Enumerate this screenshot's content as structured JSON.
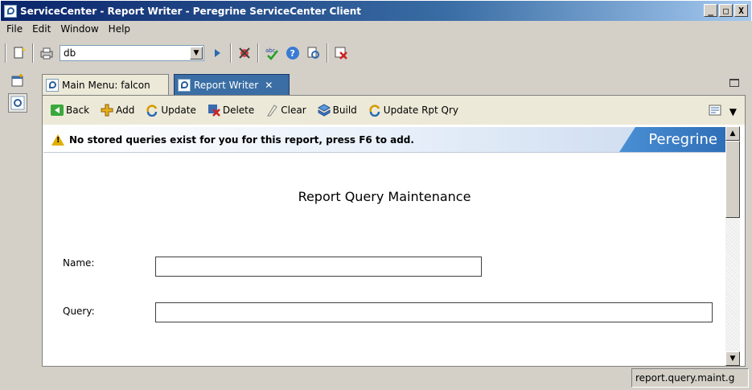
{
  "window": {
    "title": "ServiceCenter - Report Writer - Peregrine ServiceCenter Client",
    "controls": {
      "minimize": "_",
      "maximize": "□",
      "close": "X"
    }
  },
  "menu": [
    "File",
    "Edit",
    "Window",
    "Help"
  ],
  "toolbar": {
    "combo_value": "db",
    "icons": [
      "new-icon",
      "print-icon",
      "run-icon",
      "connect-icon",
      "spellcheck-icon",
      "help-icon",
      "find-icon",
      "exit-icon"
    ]
  },
  "tabs": [
    {
      "label": "Main Menu: falcon",
      "active": false
    },
    {
      "label": "Report Writer",
      "active": true,
      "close": "✕"
    }
  ],
  "actions": [
    {
      "label": "Back",
      "icon": "back-icon",
      "color": "#2a8a2a"
    },
    {
      "label": "Add",
      "icon": "add-icon",
      "color": "#d49a00"
    },
    {
      "label": "Update",
      "icon": "update-icon",
      "color": "#2a6ab0"
    },
    {
      "label": "Delete",
      "icon": "delete-icon",
      "color": "#c02020"
    },
    {
      "label": "Clear",
      "icon": "clear-icon",
      "color": "#a0a0a0"
    },
    {
      "label": "Build",
      "icon": "build-icon",
      "color": "#2a6ab0"
    },
    {
      "label": "Update Rpt Qry",
      "icon": "update-rpt-qry-icon",
      "color": "#2a6ab0"
    }
  ],
  "banner": {
    "message": "No stored queries exist for you for this report, press F6 to add.",
    "brand": "Peregrine"
  },
  "form": {
    "title": "Report Query Maintenance",
    "name_label": "Name:",
    "name_value": "",
    "query_label": "Query:",
    "query_value": ""
  },
  "status": {
    "format": "report.query.maint.g"
  }
}
